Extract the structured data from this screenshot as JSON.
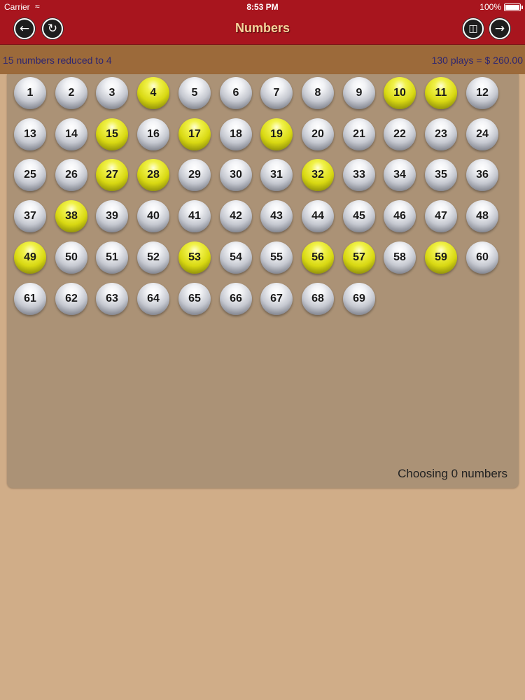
{
  "status_bar": {
    "carrier": "Carrier",
    "time": "8:53 PM",
    "battery": "100%"
  },
  "nav": {
    "title": "Numbers",
    "back_icon": "arrow-left-icon",
    "reload_icon": "reload-icon",
    "trash_icon": "trash-can-icon",
    "forward_icon": "arrow-right-icon"
  },
  "info": {
    "left_text": "15 numbers reduced to 4",
    "right_text": "130 plays = $ 260.00"
  },
  "balls": {
    "numbers": [
      "1",
      "2",
      "3",
      "4",
      "5",
      "6",
      "7",
      "8",
      "9",
      "10",
      "11",
      "12",
      "13",
      "14",
      "15",
      "16",
      "17",
      "18",
      "19",
      "20",
      "21",
      "22",
      "23",
      "24",
      "25",
      "26",
      "27",
      "28",
      "29",
      "30",
      "31",
      "32",
      "33",
      "34",
      "35",
      "36",
      "37",
      "38",
      "39",
      "40",
      "41",
      "42",
      "43",
      "44",
      "45",
      "46",
      "47",
      "48",
      "49",
      "50",
      "51",
      "52",
      "53",
      "54",
      "55",
      "56",
      "57",
      "58",
      "59",
      "60",
      "61",
      "62",
      "63",
      "64",
      "65",
      "66",
      "67",
      "68",
      "69"
    ],
    "selected": [
      "4",
      "10",
      "11",
      "15",
      "17",
      "19",
      "27",
      "28",
      "32",
      "38",
      "49",
      "53",
      "56",
      "57",
      "59"
    ]
  },
  "footer": {
    "choosing_text": "Choosing 0 numbers"
  },
  "colors": {
    "nav_bg": "#a8151e",
    "info_bg": "#9c6a3a",
    "panel_bg": "#ab9276",
    "page_bg": "#d0ad88",
    "selected_ball": "#d8d812",
    "unselected_ball": "#c5c8d0"
  }
}
